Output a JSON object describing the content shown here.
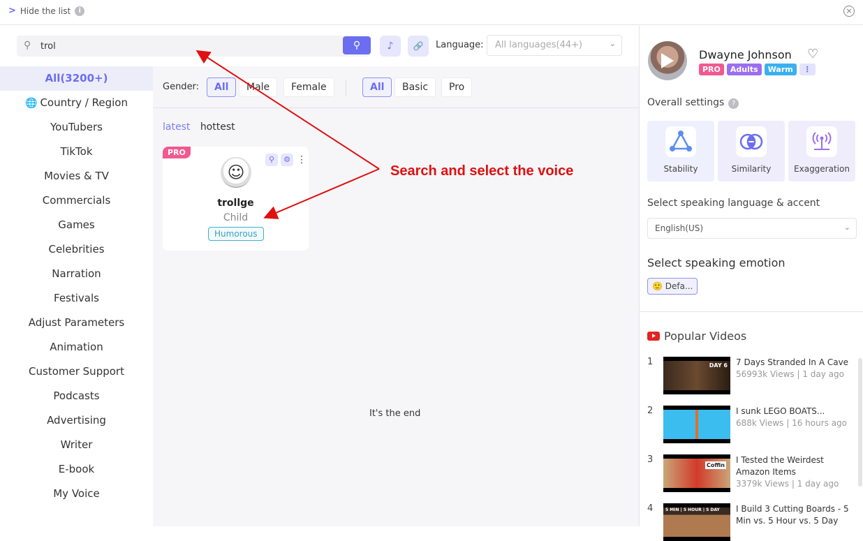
{
  "topbar": {
    "hide_label": "Hide the list",
    "chevron_glyph": ">",
    "info_glyph": "i",
    "close_glyph": "×"
  },
  "search": {
    "value": "trol",
    "placeholder": "",
    "search_glyph": "⚲",
    "button_glyph": "⚲",
    "audio_glyph": "♪",
    "link_glyph": "🔗"
  },
  "language": {
    "label": "Language:",
    "selected": "All languages(44+)",
    "dropdown_glyph": "⌄"
  },
  "sidebar": {
    "items": [
      {
        "label": "All(3200+)",
        "active": true
      },
      {
        "label": "Country / Region",
        "icon": "globe-icon"
      },
      {
        "label": "YouTubers"
      },
      {
        "label": "TikTok"
      },
      {
        "label": "Movies & TV"
      },
      {
        "label": "Commercials"
      },
      {
        "label": "Games"
      },
      {
        "label": "Celebrities"
      },
      {
        "label": "Narration"
      },
      {
        "label": "Festivals"
      },
      {
        "label": "Adjust Parameters"
      },
      {
        "label": "Animation"
      },
      {
        "label": "Customer Support"
      },
      {
        "label": "Podcasts"
      },
      {
        "label": "Advertising"
      },
      {
        "label": "Writer"
      },
      {
        "label": "E-book"
      },
      {
        "label": "My Voice"
      }
    ],
    "globe_glyph": "🌐"
  },
  "filters": {
    "gender_label": "Gender:",
    "gender_options": [
      "All",
      "Male",
      "Female"
    ],
    "gender_selected": "All",
    "tier_options": [
      "All",
      "Basic",
      "Pro"
    ],
    "tier_selected": "All"
  },
  "sort": {
    "options": [
      "latest",
      "hottest"
    ],
    "selected": "latest"
  },
  "voice_card": {
    "badge": "PRO",
    "name": "trollge",
    "gender": "Child",
    "tag": "Humorous",
    "avatar_glyph": "☺",
    "search_glyph": "⚲",
    "settings_glyph": "⚙",
    "more_glyph": "⋮"
  },
  "end_text": "It's the end",
  "annotation": {
    "text": "Search and select the voice",
    "color": "#e01010"
  },
  "right_panel": {
    "voice_name": "Dwayne Johnson",
    "heart_glyph": "♡",
    "badges": [
      {
        "label": "PRO",
        "color": "#f2598f"
      },
      {
        "label": "Adults",
        "color": "#9b6ef0"
      },
      {
        "label": "Warm",
        "color": "#3ab0f0"
      }
    ],
    "more_glyph": "⋮",
    "overall_label": "Overall settings",
    "help_glyph": "?",
    "settings_tiles": [
      {
        "label": "Stability",
        "icon": "triangle-network-icon"
      },
      {
        "label": "Similarity",
        "icon": "overlap-circles-icon"
      },
      {
        "label": "Exaggeration",
        "icon": "broadcast-tower-icon"
      }
    ],
    "lang_accent_label": "Select speaking language & accent",
    "lang_accent_value": "English(US)",
    "emotion_label": "Select speaking emotion",
    "emotion_value": "Defa...",
    "emotion_glyph": "🙂",
    "popular_label": "Popular Videos",
    "videos": [
      {
        "rank": "1",
        "title": "7 Days Stranded In A Cave",
        "meta": "56993k Views | 1 day ago",
        "thumb_text": "DAY 6"
      },
      {
        "rank": "2",
        "title": "I sunk LEGO BOATS...",
        "meta": "688k Views | 16 hours ago",
        "thumb_text": ""
      },
      {
        "rank": "3",
        "title": "I Tested the Weirdest Amazon Items",
        "meta": "3379k Views | 1 day ago",
        "thumb_text": "Coffin"
      },
      {
        "rank": "4",
        "title": "I Build 3 Cutting Boards - 5 Min vs. 5 Hour vs. 5 Day",
        "meta": "",
        "thumb_text": "5 MIN | 5 HOUR | 5 DAY"
      }
    ]
  },
  "colors": {
    "accent": "#6b6ef0",
    "pro": "#f2598f",
    "annotation": "#e01010"
  }
}
